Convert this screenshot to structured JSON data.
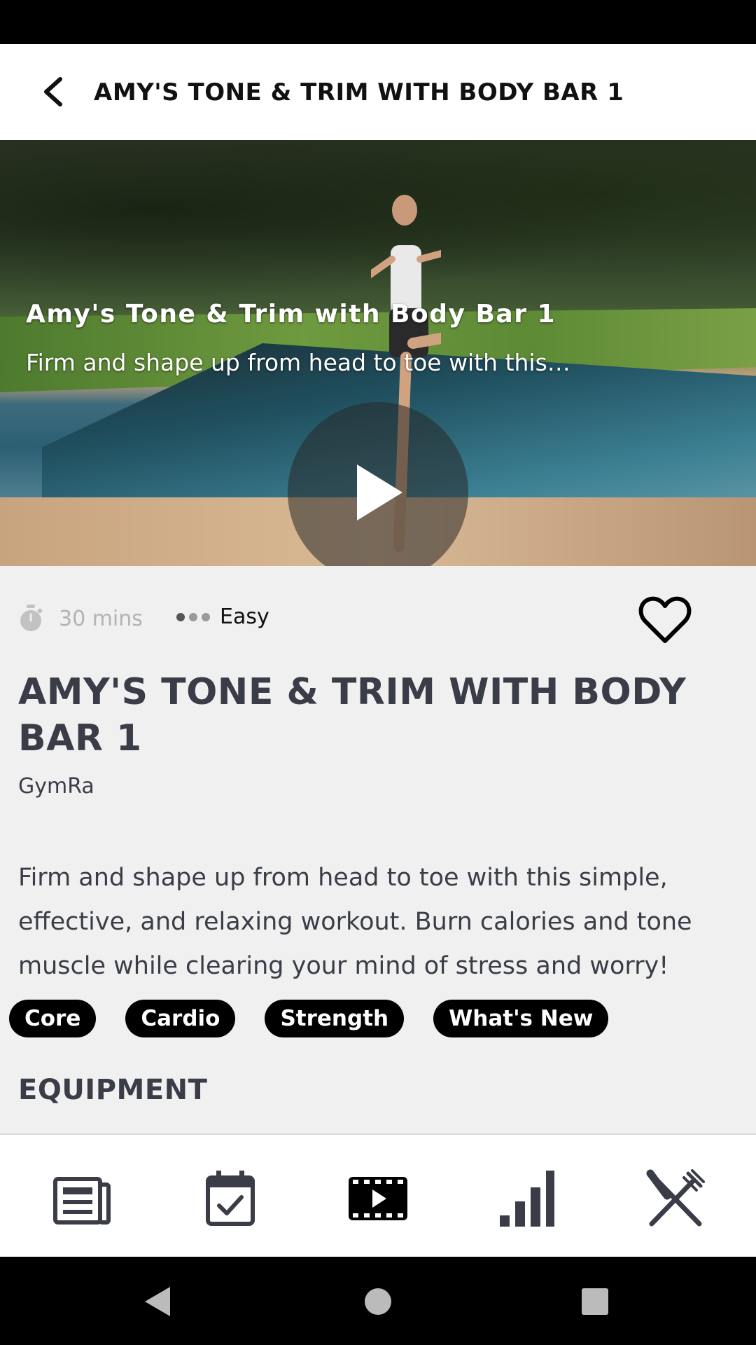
{
  "header": {
    "title": "AMY'S TONE & TRIM WITH BODY BAR 1",
    "back_icon": "chevron-left-icon"
  },
  "video": {
    "overlay_title": "Amy's Tone & Trim with Body Bar 1",
    "overlay_subtitle": "Firm and shape up from head to toe with this…",
    "play_icon": "play-icon"
  },
  "workout": {
    "duration": "30 mins",
    "difficulty": "Easy",
    "difficulty_level": 1,
    "difficulty_max": 3,
    "favorite_icon": "heart-outline-icon",
    "title": "AMY'S TONE & TRIM WITH BODY BAR 1",
    "author": "GymRa",
    "description": "Firm and shape up from head to toe with this simple, effective, and relaxing workout. Burn calories and tone muscle while clearing your mind of stress and worry!",
    "tags": [
      "Core",
      "Cardio",
      "Strength",
      "What's New"
    ],
    "equipment_heading": "EQUIPMENT"
  },
  "bottom_nav": {
    "items": [
      {
        "icon": "news-icon"
      },
      {
        "icon": "calendar-check-icon"
      },
      {
        "icon": "video-icon"
      },
      {
        "icon": "bar-chart-icon"
      },
      {
        "icon": "fork-knife-icon"
      }
    ]
  },
  "system_nav": {
    "items": [
      {
        "icon": "back-triangle-icon"
      },
      {
        "icon": "home-circle-icon"
      },
      {
        "icon": "recents-square-icon"
      }
    ]
  },
  "colors": {
    "title_text": "#3a3d47",
    "tag_bg": "#000000",
    "page_bg": "#f0f0f0"
  }
}
